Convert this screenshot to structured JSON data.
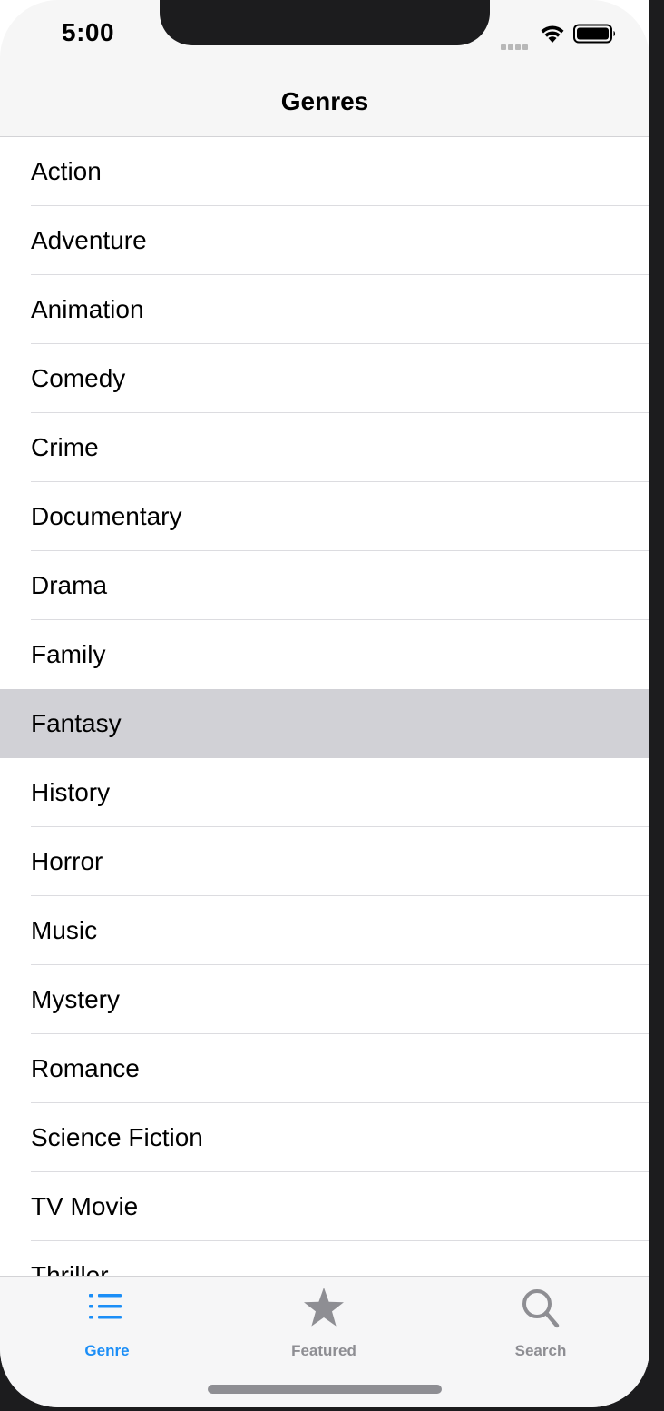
{
  "status_bar": {
    "time": "5:00"
  },
  "nav": {
    "title": "Genres"
  },
  "genres": [
    {
      "label": "Action"
    },
    {
      "label": "Adventure"
    },
    {
      "label": "Animation"
    },
    {
      "label": "Comedy"
    },
    {
      "label": "Crime"
    },
    {
      "label": "Documentary"
    },
    {
      "label": "Drama"
    },
    {
      "label": "Family"
    },
    {
      "label": "Fantasy"
    },
    {
      "label": "History"
    },
    {
      "label": "Horror"
    },
    {
      "label": "Music"
    },
    {
      "label": "Mystery"
    },
    {
      "label": "Romance"
    },
    {
      "label": "Science Fiction"
    },
    {
      "label": "TV Movie"
    },
    {
      "label": "Thriller"
    }
  ],
  "selected_genre": "Fantasy",
  "tabs": [
    {
      "label": "Genre",
      "icon": "list-icon",
      "active": true
    },
    {
      "label": "Featured",
      "icon": "star-icon",
      "active": false
    },
    {
      "label": "Search",
      "icon": "magnifier-icon",
      "active": false
    }
  ],
  "colors": {
    "accent": "#1b8ef7",
    "inactive": "#8e8e93",
    "selected_row": "#d1d1d6"
  }
}
